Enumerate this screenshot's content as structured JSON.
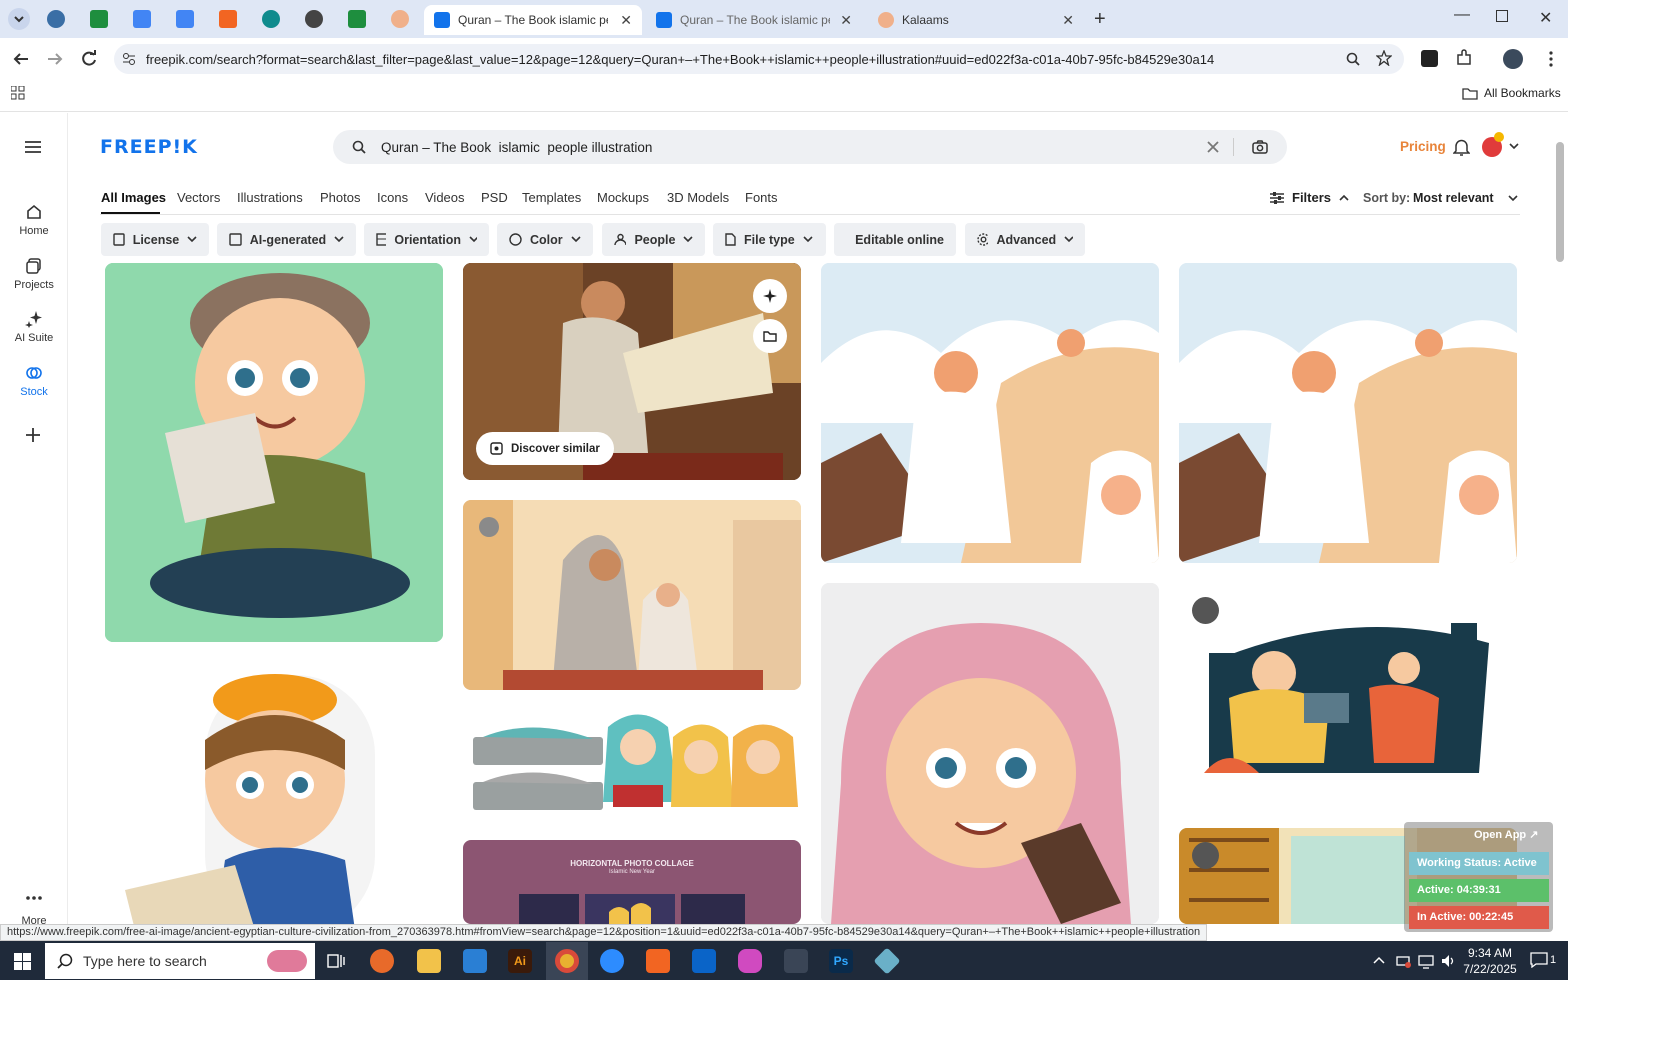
{
  "browser": {
    "tabs": [
      {
        "title": "Quran – The Book islamic peop",
        "active": true
      },
      {
        "title": "Quran – The Book islamic peop",
        "active": false
      },
      {
        "title": "Kalaams",
        "active": false
      }
    ],
    "url": "freepik.com/search?format=search&last_filter=page&last_value=12&page=12&query=Quran+–+The+Book++islamic++people+illustration#uuid=ed022f3a-c01a-40b7-95fc-b84529e30a14",
    "bookmarks_label": "All Bookmarks",
    "status_url": "https://www.freepik.com/free-ai-image/ancient-egyptian-culture-civilization-from_270363978.htm#fromView=search&page=12&position=1&uuid=ed022f3a-c01a-40b7-95fc-b84529e30a14&query=Quran+–+The+Book++islamic++people+illustration"
  },
  "site": {
    "logo": "FREEP!K",
    "search_value": "Quran – The Book  islamic  people illustration",
    "pricing": "Pricing",
    "sidebar": [
      "Home",
      "Projects",
      "AI Suite",
      "Stock",
      "More"
    ],
    "categories": [
      "All Images",
      "Vectors",
      "Illustrations",
      "Photos",
      "Icons",
      "Videos",
      "PSD",
      "Templates",
      "Mockups",
      "3D Models",
      "Fonts"
    ],
    "filters_label": "Filters",
    "sort_label": "Sort by:",
    "sort_value": "Most relevant",
    "filter_buttons": [
      "License",
      "AI-generated",
      "Orientation",
      "Color",
      "People",
      "File type",
      "Editable online",
      "Advanced"
    ],
    "discover_similar": "Discover similar",
    "collage_title": "HORIZONTAL PHOTO COLLAGE",
    "collage_sub": "Islamic New Year"
  },
  "widget": {
    "open_app": "Open App ↗",
    "working_status": "Working Status: Active",
    "active": "Active: 04:39:31",
    "inactive": "In Active: 00:22:45"
  },
  "taskbar": {
    "search_placeholder": "Type here to search",
    "time": "9:34 AM",
    "date": "7/22/2025",
    "notifications": "1"
  }
}
